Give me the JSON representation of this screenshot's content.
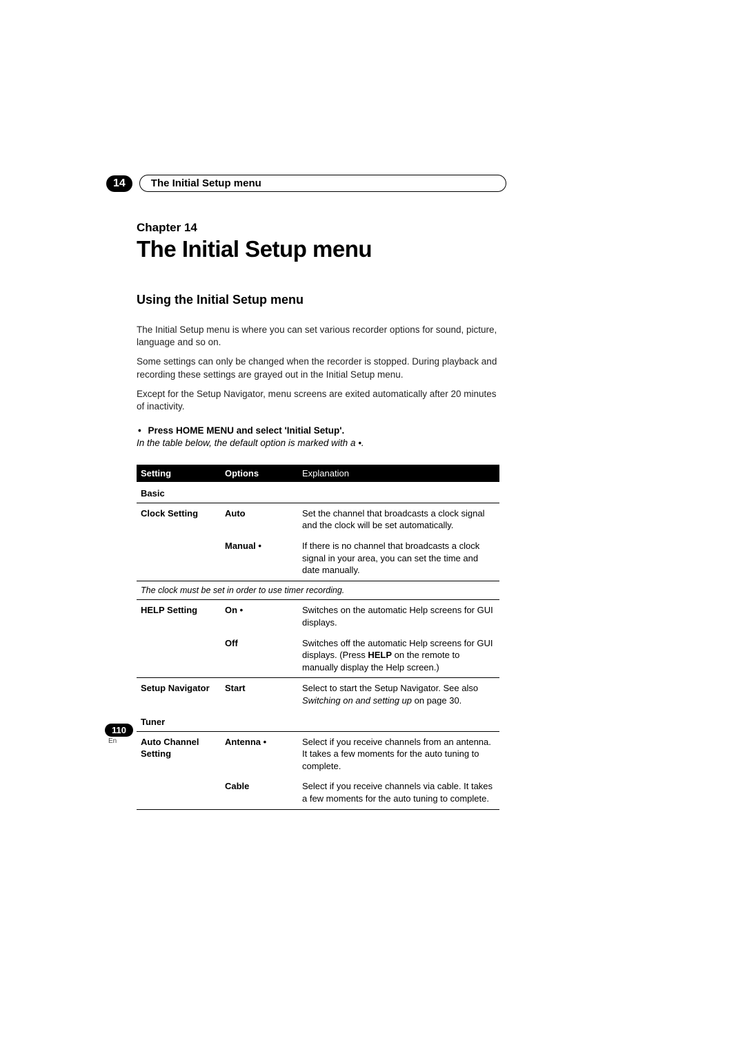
{
  "header": {
    "chapter_num": "14",
    "pill_text": "The Initial Setup menu",
    "chapter_label": "Chapter 14",
    "chapter_title": "The Initial Setup menu"
  },
  "section": {
    "heading": "Using the Initial Setup menu",
    "para1": "The Initial Setup menu is where you can set various recorder options for sound, picture, language and so on.",
    "para2": "Some settings can only be changed when the recorder is stopped. During playback and recording these settings are grayed out in the Initial Setup menu.",
    "para3": "Except for the Setup Navigator, menu screens are exited automatically after 20 minutes of inactivity.",
    "instruction": "Press HOME MENU and select 'Initial Setup'.",
    "note": "In the table below, the default option is marked with a •."
  },
  "table": {
    "headers": {
      "setting": "Setting",
      "options": "Options",
      "explanation": "Explanation"
    },
    "sections": {
      "basic": "Basic",
      "tuner": "Tuner"
    },
    "rows": {
      "clock_setting": "Clock Setting",
      "clock_auto_opt": "Auto",
      "clock_auto_exp": "Set the channel that broadcasts a clock signal and the clock will be set automatically.",
      "clock_manual_opt": "Manual •",
      "clock_manual_exp": "If there is no channel that broadcasts a clock signal in your area, you can set the time and date manually.",
      "clock_note": "The clock must be set in order to use timer recording.",
      "help_setting": "HELP Setting",
      "help_on_opt": "On •",
      "help_on_exp": "Switches on the automatic Help screens for GUI displays.",
      "help_off_opt": "Off",
      "help_off_exp_pre": "Switches off the automatic Help screens for GUI displays. (Press ",
      "help_off_exp_bold": "HELP",
      "help_off_exp_post": " on the remote to manually display the Help screen.)",
      "setup_nav": "Setup Navigator",
      "setup_nav_opt": "Start",
      "setup_nav_exp_pre": "Select to start the Setup Navigator. See also ",
      "setup_nav_exp_italic": "Switching on and setting up",
      "setup_nav_exp_post": " on page 30.",
      "auto_ch": "Auto Channel Setting",
      "auto_ch_antenna_opt": "Antenna •",
      "auto_ch_antenna_exp": "Select if you receive channels from an antenna. It takes a few moments for the auto tuning to complete.",
      "auto_ch_cable_opt": "Cable",
      "auto_ch_cable_exp": "Select if you receive channels via cable. It takes a few moments for the auto tuning to complete."
    }
  },
  "footer": {
    "page_number": "110",
    "lang": "En"
  }
}
